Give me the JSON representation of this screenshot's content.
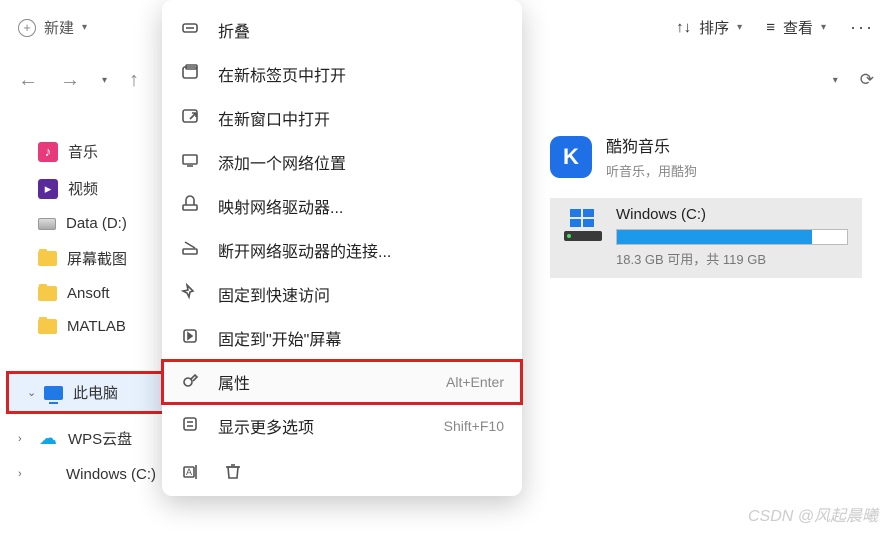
{
  "toolbar": {
    "new_label": "新建",
    "sort_label": "排序",
    "view_label": "查看"
  },
  "sidebar": {
    "items": [
      {
        "label": "音乐",
        "icon": "music"
      },
      {
        "label": "视频",
        "icon": "video"
      },
      {
        "label": "Data (D:)",
        "icon": "disk"
      },
      {
        "label": "屏幕截图",
        "icon": "folder"
      },
      {
        "label": "Ansoft",
        "icon": "folder"
      },
      {
        "label": "MATLAB",
        "icon": "folder"
      }
    ],
    "tree": [
      {
        "label": "此电脑",
        "icon": "monitor",
        "selected": true
      },
      {
        "label": "WPS云盘",
        "icon": "cloud"
      },
      {
        "label": "Windows (C:)",
        "icon": "win"
      }
    ]
  },
  "context_menu": {
    "items": [
      {
        "label": "折叠",
        "icon": "collapse",
        "shortcut": ""
      },
      {
        "label": "在新标签页中打开",
        "icon": "new-tab",
        "shortcut": ""
      },
      {
        "label": "在新窗口中打开",
        "icon": "new-window",
        "shortcut": ""
      },
      {
        "label": "添加一个网络位置",
        "icon": "net-location",
        "shortcut": ""
      },
      {
        "label": "映射网络驱动器...",
        "icon": "map-drive",
        "shortcut": ""
      },
      {
        "label": "断开网络驱动器的连接...",
        "icon": "disconnect-drive",
        "shortcut": ""
      },
      {
        "label": "固定到快速访问",
        "icon": "pin-quick",
        "shortcut": ""
      },
      {
        "label": "固定到\"开始\"屏幕",
        "icon": "pin-start",
        "shortcut": ""
      },
      {
        "label": "属性",
        "icon": "properties",
        "shortcut": "Alt+Enter",
        "highlight": true
      },
      {
        "label": "显示更多选项",
        "icon": "more-options",
        "shortcut": "Shift+F10"
      }
    ]
  },
  "main": {
    "app": {
      "title": "酷狗音乐",
      "subtitle": "听音乐，用酷狗",
      "icon_letter": "K"
    },
    "drive": {
      "name": "Windows (C:)",
      "used_pct": 84.6,
      "status": "18.3 GB 可用，共 119 GB"
    }
  },
  "watermark": "CSDN @风起晨曦"
}
